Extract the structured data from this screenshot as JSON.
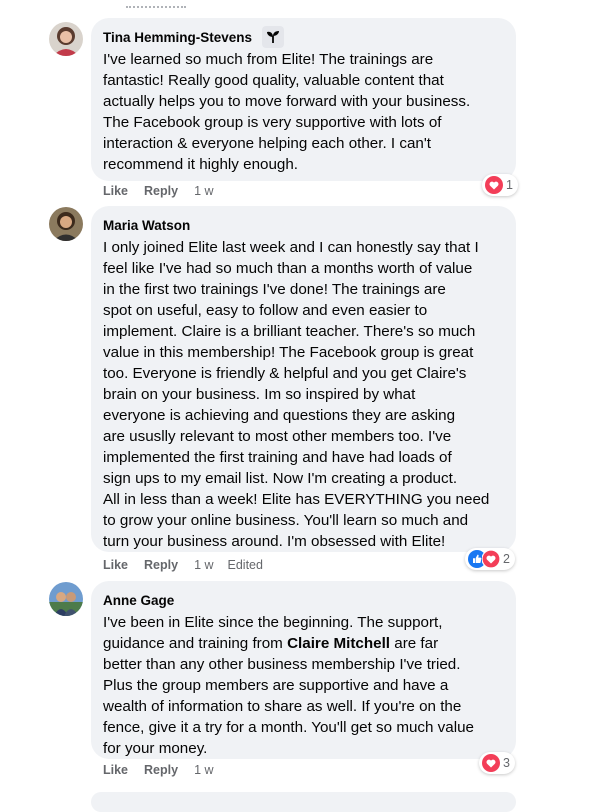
{
  "comments": [
    {
      "author": "Tina Hemming-Stevens",
      "text": "I've learned so much from Elite! The trainings are\nfantastic! Really good quality, valuable content that\nactually helps you to move forward with your business.\nThe Facebook group is very supportive with lots of\ninteraction & everyone helping each other. I can't\nrecommend it highly enough.",
      "like": "Like",
      "reply": "Reply",
      "time": "1 w",
      "reaction_count": "1",
      "reaction_icons": [
        "love-icon"
      ]
    },
    {
      "author": "Maria Watson",
      "text": "I only joined Elite last week and I can honestly say that I\nfeel like I've had so much than a months worth of value\nin the first two trainings I've done! The trainings are\nspot on useful, easy to follow and even easier to\nimplement. Claire is a brilliant teacher. There's so much\nvalue in this membership! The Facebook group is great\ntoo. Everyone is friendly & helpful and you get Claire's\nbrain on your business. Im so inspired by what\neveryone is achieving and questions they are asking\nare ususlly relevant to most other members too. I've\nimplemented the first training and have had loads of\nsign ups to my email list. Now I'm creating a product.\nAll in less than a week! Elite has EVERYTHING you need\nto grow your online business. You'll learn so much and\nturn your business around. I'm obsessed with Elite!",
      "like": "Like",
      "reply": "Reply",
      "time": "1 w",
      "edited": "Edited",
      "reaction_count": "2",
      "reaction_icons": [
        "like-icon",
        "love-icon"
      ]
    },
    {
      "author": "Anne Gage",
      "text_before": "I've been in Elite since the beginning. The support,\nguidance and training from ",
      "mention": "Claire Mitchell",
      "text_after": " are far\nbetter than any other business membership I've tried.\nPlus the group members are supportive and have a\nwealth of information to share as well. If you're on the\nfence, give it a try for a month. You'll get so much value\nfor your money.",
      "like": "Like",
      "reply": "Reply",
      "time": "1 w",
      "reaction_count": "3",
      "reaction_icons": [
        "love-icon"
      ]
    }
  ],
  "colors": {
    "bubble": "#f0f2f5",
    "meta_text": "#65676b",
    "like_blue": "#1877f2",
    "love_red": "#f33e58"
  }
}
